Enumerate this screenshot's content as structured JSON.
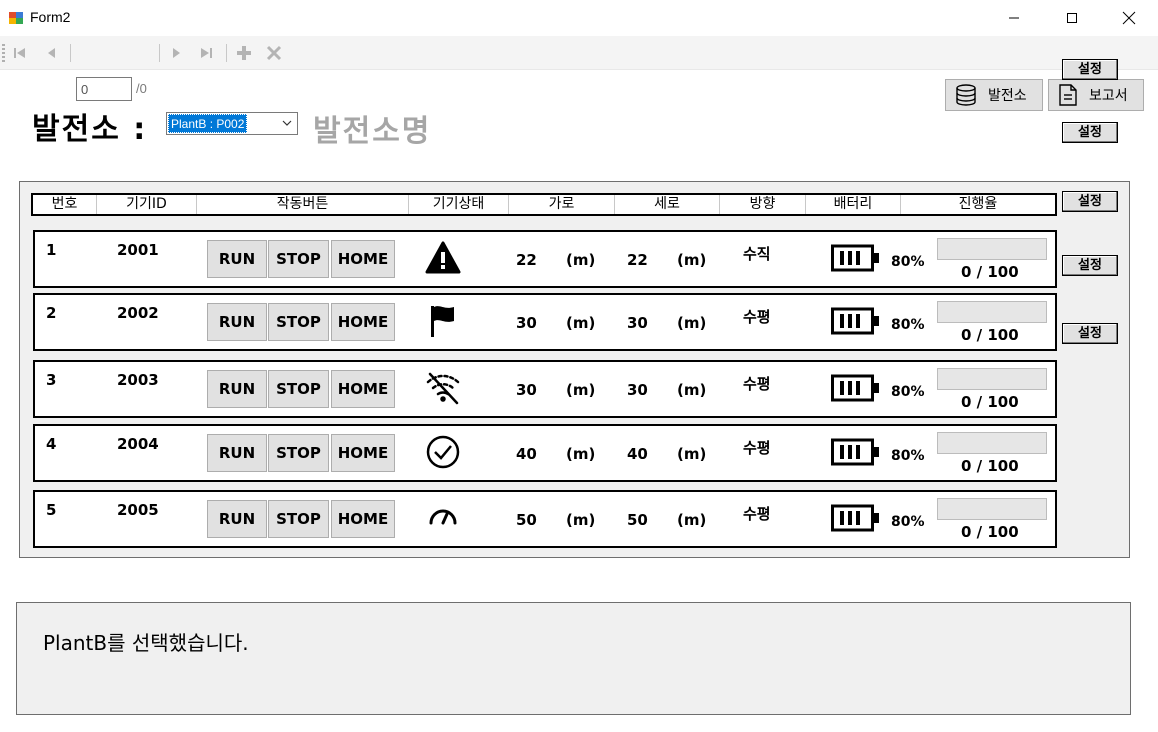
{
  "window": {
    "title": "Form2"
  },
  "navigator": {
    "position": "0",
    "count_label": "/0"
  },
  "header_area": {
    "plant_label": "발전소 :",
    "selected_plant": "PlantB : P002",
    "plant_name": "발전소명",
    "plant_button": "발전소",
    "report_button": "보고서"
  },
  "table": {
    "columns": [
      "번호",
      "기기ID",
      "작동버튼",
      "기기상태",
      "가로",
      "세로",
      "방향",
      "배터리",
      "진행율"
    ],
    "unit": "(m)",
    "run_label": "RUN",
    "stop_label": "STOP",
    "home_label": "HOME",
    "set_label": "설정",
    "rows": [
      {
        "no": "1",
        "id": "2001",
        "status_icon": "warning-icon",
        "width": "22",
        "height": "22",
        "dir": "수직",
        "battery": "80%",
        "progress": "0  / 100",
        "progress_value": 0
      },
      {
        "no": "2",
        "id": "2002",
        "status_icon": "flag-icon",
        "width": "30",
        "height": "30",
        "dir": "수평",
        "battery": "80%",
        "progress": "0  / 100",
        "progress_value": 0
      },
      {
        "no": "3",
        "id": "2003",
        "status_icon": "wifi-off-icon",
        "width": "30",
        "height": "30",
        "dir": "수평",
        "battery": "80%",
        "progress": "0  / 100",
        "progress_value": 0
      },
      {
        "no": "4",
        "id": "2004",
        "status_icon": "check-circle-icon",
        "width": "40",
        "height": "40",
        "dir": "수평",
        "battery": "80%",
        "progress": "0  / 100",
        "progress_value": 0
      },
      {
        "no": "5",
        "id": "2005",
        "status_icon": "speedometer-icon",
        "width": "50",
        "height": "50",
        "dir": "수평",
        "battery": "80%",
        "progress": "0  / 100",
        "progress_value": 0
      }
    ]
  },
  "message": "PlantB를 선택했습니다."
}
